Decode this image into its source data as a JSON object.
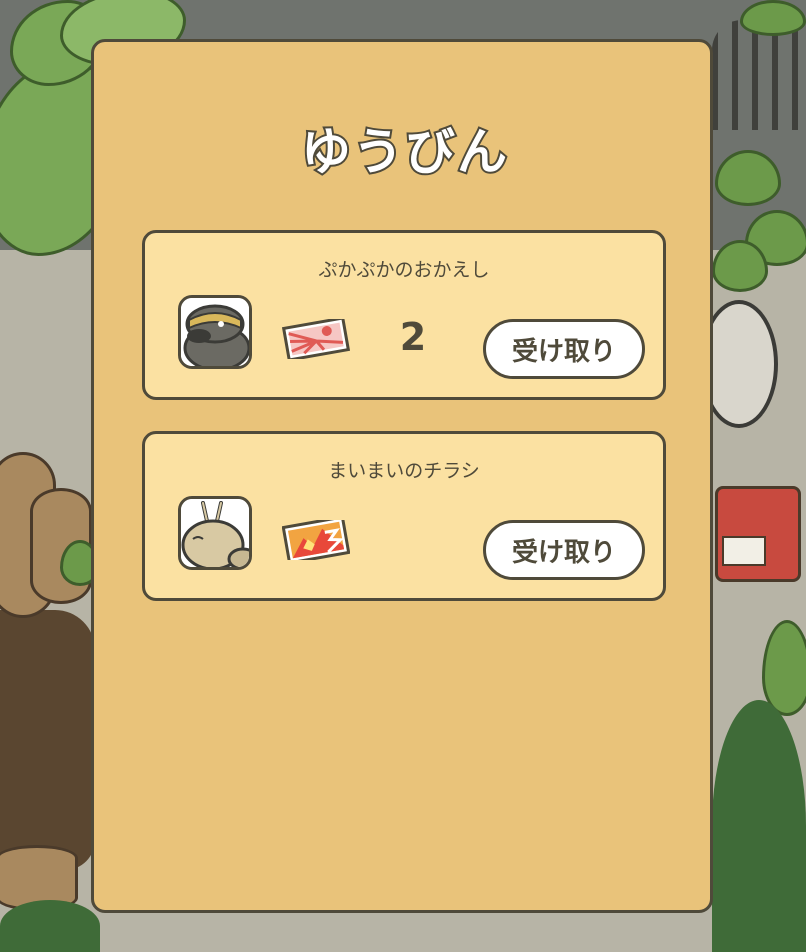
{
  "screen": {
    "title": "ゆうびん"
  },
  "mail": [
    {
      "sender": "ぷかぷかのおかえし",
      "sender_icon": "mole-badger-avatar",
      "item_icon": "rising-sun-ticket-icon",
      "count": "2",
      "button_label": "受け取り"
    },
    {
      "sender": "まいまいのチラシ",
      "sender_icon": "snail-avatar",
      "item_icon": "flyer-icon",
      "count": "",
      "button_label": "受け取り"
    }
  ],
  "colors": {
    "panel": "#e9c37a",
    "card": "#fbe1a2",
    "outline": "#4f4a3a",
    "button": "#ffffff"
  }
}
